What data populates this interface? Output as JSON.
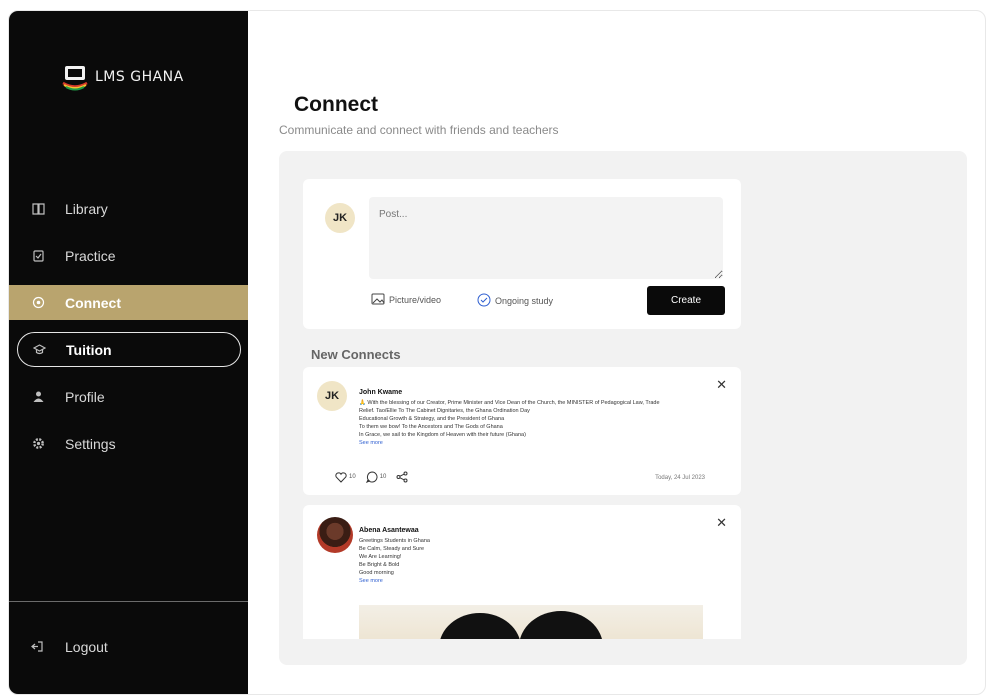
{
  "app": {
    "logo_text": "LMS GHANA"
  },
  "sidebar": {
    "items": [
      {
        "label": "Library",
        "icon": "book-icon"
      },
      {
        "label": "Practice",
        "icon": "clipboard-icon"
      },
      {
        "label": "Connect",
        "icon": "connect-icon",
        "active": true
      },
      {
        "label": "Tuition",
        "icon": "graduation-icon",
        "outlined": true
      },
      {
        "label": "Profile",
        "icon": "user-icon"
      },
      {
        "label": "Settings",
        "icon": "gear-icon"
      }
    ],
    "logout_label": "Logout"
  },
  "page": {
    "title": "Connect",
    "subtitle": "Communicate and connect with friends and teachers"
  },
  "composer": {
    "avatar_initials": "JK",
    "placeholder": "Post...",
    "action_media": "Picture/video",
    "action_study": "Ongoing study",
    "create_label": "Create"
  },
  "feed": {
    "heading": "New Connects",
    "posts": [
      {
        "avatar_initials": "JK",
        "author": "John Kwame",
        "lines": [
          "🙏 With the blessing of our Creator, Prime Minister and Vice Dean of the Church, the MINISTER of Pedagogical Law, Trade",
          "Relief. Tao/Ellie To The Cabinet Dignitaries, the Ghana Ordination Day",
          "Educational Growth & Strategy, and the President of Ghana",
          "To them we bow! To the Ancestors and The Gods of Ghana",
          "In Grace, we sail to the Kingdom of Heaven with their future (Ghana)"
        ],
        "see_more": "See more",
        "likes": "10",
        "comments": "10",
        "date": "Today, 24 Jul 2023"
      },
      {
        "author": "Abena Asantewaa",
        "lines": [
          "Greetings Students in Ghana",
          "Be Calm, Steady and Sure",
          "We Are Learning!",
          "Be Bright & Bold",
          "Good morning"
        ],
        "see_more": "See more"
      }
    ]
  },
  "colors": {
    "sidebar_bg": "#0a0a0a",
    "accent_gold": "#b9a46e",
    "panel_bg": "#f2f2f2",
    "link_blue": "#2f5fd0"
  }
}
